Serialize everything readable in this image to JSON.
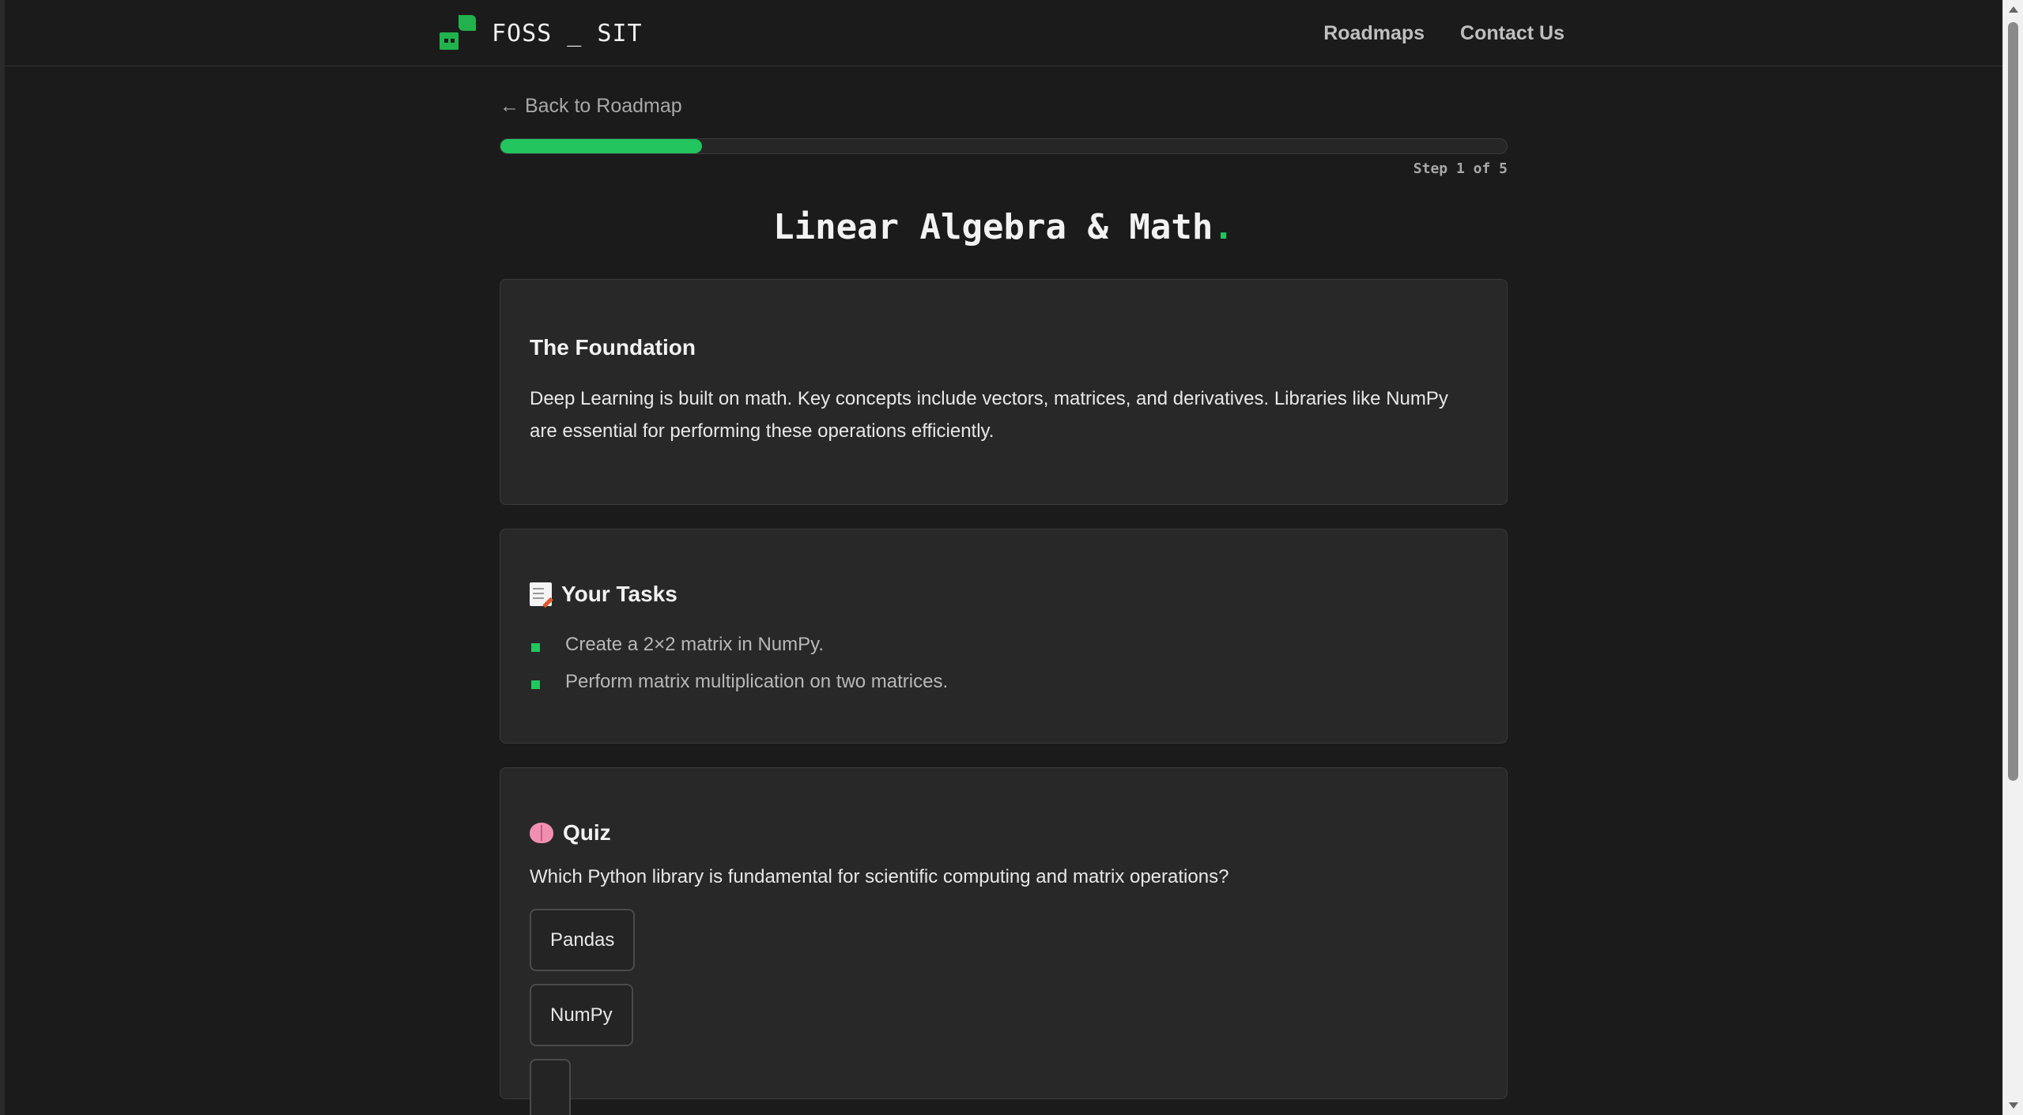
{
  "header": {
    "brand": "FOSS _ SIT",
    "nav": [
      {
        "label": "Roadmaps"
      },
      {
        "label": "Contact Us"
      }
    ]
  },
  "lesson": {
    "back_link": "← Back to Roadmap",
    "progress_fraction": 0.2,
    "step_text": "Step 1 of 5",
    "title": "Linear Algebra & Math",
    "title_dot": "."
  },
  "foundation": {
    "heading": "The Foundation",
    "body": "Deep Learning is built on math. Key concepts include vectors, matrices, and derivatives. Libraries like NumPy are essential for performing these operations efficiently."
  },
  "tasks": {
    "icon": "memo-icon",
    "heading": "Your Tasks",
    "items": [
      "Create a 2×2 matrix in NumPy.",
      "Perform matrix multiplication on two matrices."
    ]
  },
  "quiz": {
    "icon": "brain-icon",
    "heading": "Quiz",
    "question": "Which Python library is fundamental for scientific computing and matrix operations?",
    "options": [
      "Pandas",
      "NumPy"
    ]
  },
  "colors": {
    "accent": "#22c55e",
    "background": "#1b1b1b",
    "card": "#282828"
  }
}
